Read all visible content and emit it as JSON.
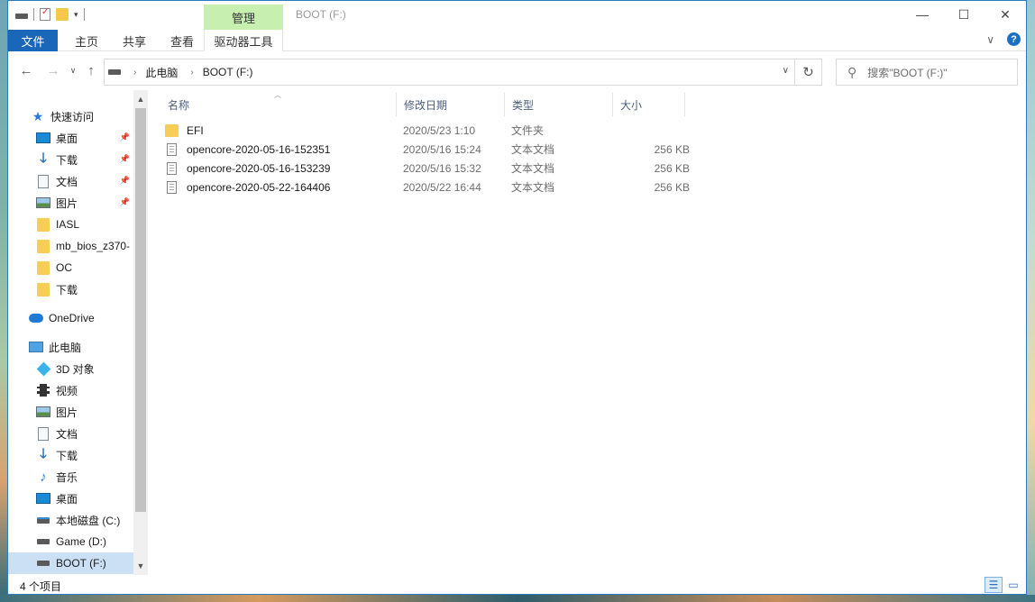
{
  "window": {
    "title": "BOOT (F:)",
    "manage_tab": "管理"
  },
  "ribbon": {
    "tabs": [
      "文件",
      "主页",
      "共享",
      "查看"
    ],
    "contextual_tab": "驱动器工具"
  },
  "address": {
    "crumbs": [
      "此电脑",
      "BOOT (F:)"
    ],
    "search_placeholder": "搜索\"BOOT (F:)\""
  },
  "sidebar": {
    "items": [
      {
        "label": "快速访问",
        "icon": "star-icon"
      },
      {
        "label": "桌面",
        "icon": "desktop-icon",
        "pinned": true
      },
      {
        "label": "下载",
        "icon": "download-icon",
        "pinned": true
      },
      {
        "label": "文档",
        "icon": "document-icon",
        "pinned": true
      },
      {
        "label": "图片",
        "icon": "picture-icon",
        "pinned": true
      },
      {
        "label": "IASL",
        "icon": "folder-icon"
      },
      {
        "label": "mb_bios_z370-",
        "icon": "folder-icon"
      },
      {
        "label": "OC",
        "icon": "folder-icon"
      },
      {
        "label": "下载",
        "icon": "folder-icon"
      },
      {
        "label": "OneDrive",
        "icon": "cloud-icon"
      },
      {
        "label": "此电脑",
        "icon": "pc-icon"
      },
      {
        "label": "3D 对象",
        "icon": "cube-icon"
      },
      {
        "label": "视频",
        "icon": "video-icon"
      },
      {
        "label": "图片",
        "icon": "picture-icon"
      },
      {
        "label": "文档",
        "icon": "document-icon"
      },
      {
        "label": "下载",
        "icon": "download-icon"
      },
      {
        "label": "音乐",
        "icon": "music-icon"
      },
      {
        "label": "桌面",
        "icon": "desktop-icon"
      },
      {
        "label": "本地磁盘 (C:)",
        "icon": "system-drive-icon"
      },
      {
        "label": "Game (D:)",
        "icon": "drive-icon"
      },
      {
        "label": "BOOT (F:)",
        "icon": "drive-icon",
        "selected": true
      }
    ]
  },
  "list": {
    "columns": [
      "名称",
      "修改日期",
      "类型",
      "大小"
    ],
    "rows": [
      {
        "name": "EFI",
        "date": "2020/5/23 1:10",
        "type": "文件夹",
        "size": "",
        "icon": "folder-icon"
      },
      {
        "name": "opencore-2020-05-16-152351",
        "date": "2020/5/16 15:24",
        "type": "文本文档",
        "size": "256 KB",
        "icon": "text-file-icon"
      },
      {
        "name": "opencore-2020-05-16-153239",
        "date": "2020/5/16 15:32",
        "type": "文本文档",
        "size": "256 KB",
        "icon": "text-file-icon"
      },
      {
        "name": "opencore-2020-05-22-164406",
        "date": "2020/5/22 16:44",
        "type": "文本文档",
        "size": "256 KB",
        "icon": "text-file-icon"
      }
    ]
  },
  "status": {
    "item_count": "4 个项目"
  },
  "colors": {
    "file_tab": "#1a66b8",
    "manage_tab": "#c6efb0",
    "selection": "#cce0f5",
    "header_text": "#4c607a"
  }
}
